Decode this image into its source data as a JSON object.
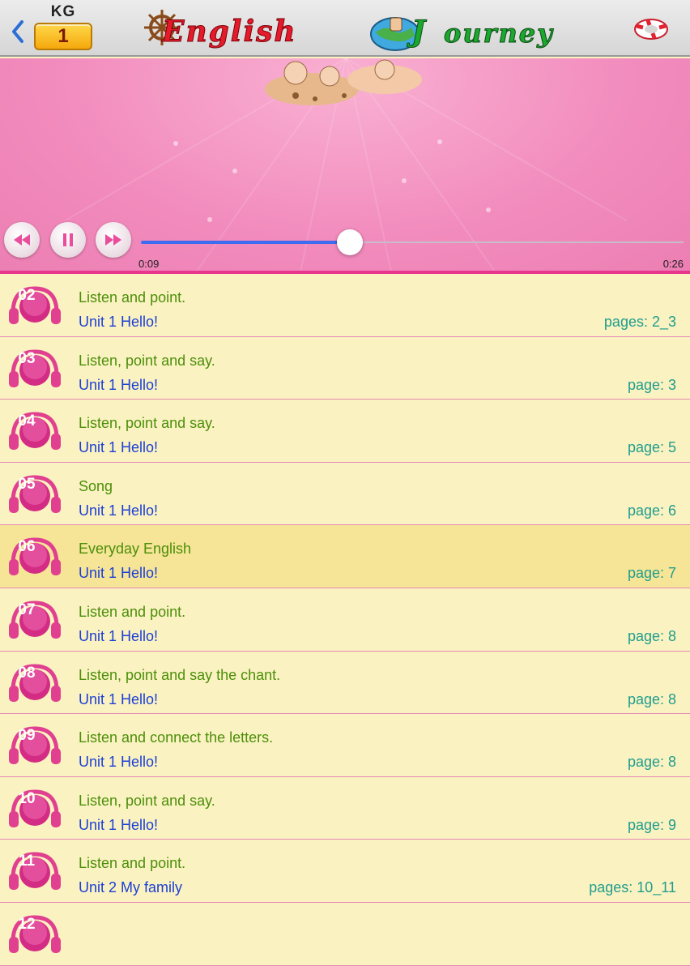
{
  "header": {
    "grade_label": "KG",
    "grade_number": "1",
    "logo_word_1": "English",
    "logo_word_2": "ourney",
    "logo_initial_2": "J"
  },
  "player": {
    "current_time": "0:09",
    "total_time": "0:26",
    "progress": 0.385,
    "state": "playing"
  },
  "colors": {
    "accent_pink": "#e8368e",
    "title_green": "#4b8f0a",
    "unit_blue": "#1b3fd6",
    "pages_teal": "#1f9d8e",
    "active_row": "#f6e596"
  },
  "tracks": [
    {
      "num": "02",
      "title": "Listen and point.",
      "unit": "Unit 1 Hello!",
      "pages": "pages: 2_3",
      "active": false
    },
    {
      "num": "03",
      "title": "Listen, point and say.",
      "unit": "Unit 1 Hello!",
      "pages": "page: 3",
      "active": false
    },
    {
      "num": "04",
      "title": "Listen, point and say.",
      "unit": "Unit 1 Hello!",
      "pages": "page: 5",
      "active": false
    },
    {
      "num": "05",
      "title": "Song",
      "unit": "Unit 1 Hello!",
      "pages": "page: 6",
      "active": false
    },
    {
      "num": "06",
      "title": "Everyday English",
      "unit": "Unit 1 Hello!",
      "pages": "page: 7",
      "active": true
    },
    {
      "num": "07",
      "title": "Listen and point.",
      "unit": "Unit 1 Hello!",
      "pages": "page: 8",
      "active": false
    },
    {
      "num": "08",
      "title": "Listen, point and say the chant.",
      "unit": "Unit 1 Hello!",
      "pages": "page: 8",
      "active": false
    },
    {
      "num": "09",
      "title": "Listen and connect the letters.",
      "unit": "Unit 1 Hello!",
      "pages": "page: 8",
      "active": false
    },
    {
      "num": "10",
      "title": "Listen, point and say.",
      "unit": "Unit 1 Hello!",
      "pages": "page: 9",
      "active": false
    },
    {
      "num": "11",
      "title": "Listen and point.",
      "unit": "Unit 2 My family",
      "pages": "pages: 10_11",
      "active": false
    },
    {
      "num": "12",
      "title": "",
      "unit": "",
      "pages": "",
      "active": false
    }
  ]
}
